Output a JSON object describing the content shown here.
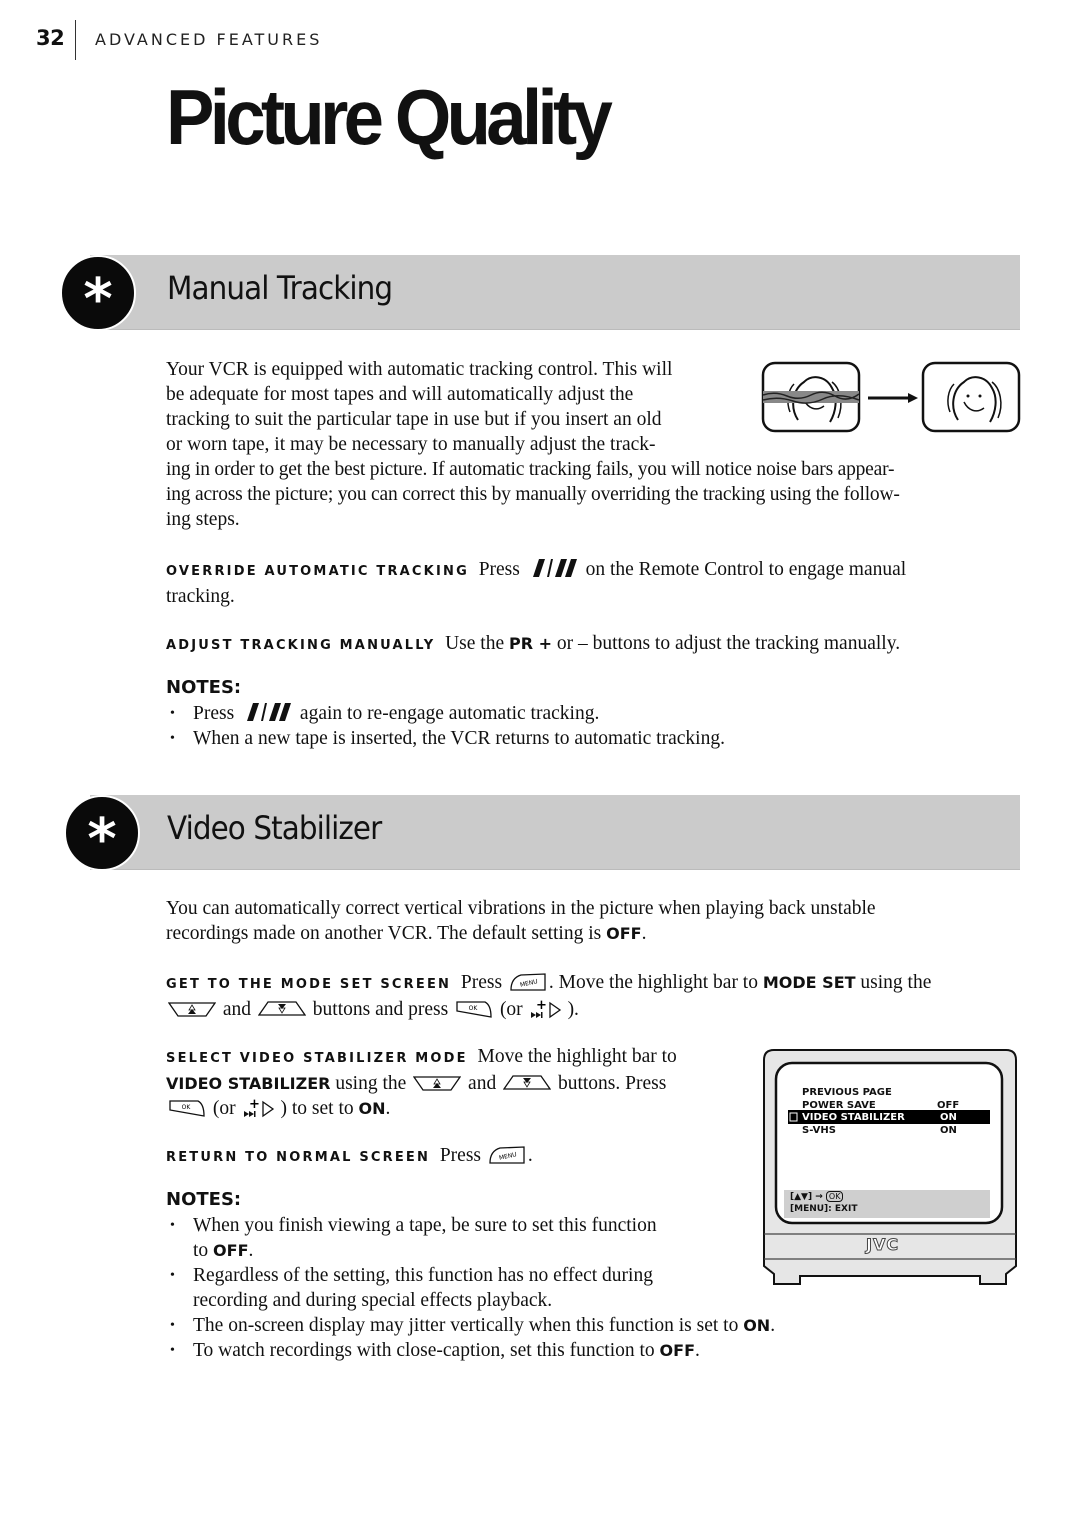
{
  "header": {
    "page_number": "32",
    "section": "ADVANCED FEATURES",
    "title": "Picture Quality"
  },
  "manual_tracking": {
    "heading": "Manual Tracking",
    "badge_icon": "asterisk-icon",
    "intro_lines": [
      "Your VCR is equipped with automatic tracking control. This will",
      "be adequate for most tapes and will automatically adjust the",
      "tracking to suit the particular tape in use but if you insert an old",
      "or worn tape, it may be necessary to manually adjust the track-"
    ],
    "intro_lines_wide": [
      "ing in order to get the best picture. If automatic tracking fails, you will notice noise bars appear-",
      "ing across the picture; you can correct this by manually overriding the tracking using the follow-",
      "ing steps."
    ],
    "illustration": {
      "before": "noisy-tv-picture-icon",
      "arrow": "arrow-right-icon",
      "after": "clear-tv-picture-icon"
    },
    "steps": [
      {
        "lead": "OVERRIDE AUTOMATIC TRACKING",
        "pre": "Press",
        "icon": "tracking-button-icon",
        "post": "on the Remote Control to engage manual",
        "cont": "tracking."
      },
      {
        "lead": "ADJUST TRACKING MANUALLY",
        "pre": "Use the",
        "bold": "PR +",
        "post": "or – buttons to adjust the tracking manually."
      }
    ],
    "notes_heading": "NOTES:",
    "notes": [
      {
        "pre": "Press",
        "icon": "tracking-button-icon",
        "post": "again to re-engage automatic tracking."
      },
      {
        "text": "When a new tape is inserted, the VCR returns to automatic tracking."
      }
    ]
  },
  "video_stabilizer": {
    "heading": "Video Stabilizer",
    "badge_icon": "asterisk-icon",
    "intro_line1": "You can automatically correct vertical vibrations in the picture when playing back unstable",
    "intro_line2_pre": "recordings made on another VCR. The default setting is",
    "intro_line2_bold": "OFF",
    "intro_line2_post": ".",
    "step1": {
      "lead": "GET TO THE MODE SET SCREEN",
      "pre": "Press",
      "mid": ". Move the highlight bar to",
      "bold": "MODE SET",
      "post": "using the",
      "l2_and": "and",
      "l2_mid": "buttons and press",
      "l2_or": "(or",
      "l2_end": ")."
    },
    "step2": {
      "lead": "SELECT VIDEO STABILIZER MODE",
      "l1": "Move the highlight bar to",
      "l2_bold": "VIDEO STABILIZER",
      "l2_pre": "using the",
      "l2_and": "and",
      "l2_post": "buttons. Press",
      "l3_or": "(or",
      "l3_mid": ") to set to",
      "l3_bold": "ON",
      "l3_end": "."
    },
    "step3": {
      "lead": "RETURN TO NORMAL SCREEN",
      "pre": "Press",
      "post": "."
    },
    "notes_heading": "NOTES:",
    "notes": [
      {
        "l1": "When you finish viewing a tape, be sure to set this function",
        "l2_pre": "to",
        "bold": "OFF",
        "post": "."
      },
      {
        "l1": "Regardless of the setting, this function has no effect during",
        "l2": "recording and during special effects playback."
      },
      {
        "pre": "The on-screen display may jitter vertically when this function is set to",
        "bold": "ON",
        "post": "."
      },
      {
        "pre": "To watch recordings with close-caption, set this function to",
        "bold": "OFF",
        "post": "."
      }
    ],
    "tv_screen": {
      "menu": [
        {
          "label": "PREVIOUS PAGE",
          "value": ""
        },
        {
          "label": "POWER SAVE",
          "value": "OFF"
        },
        {
          "label": "VIDEO STABILIZER",
          "value": "ON",
          "selected": true
        },
        {
          "label": "S-VHS",
          "value": "ON"
        }
      ],
      "help_line1": "[▲▼] →",
      "help_ok": "OK",
      "help_line2": "[MENU]: EXIT",
      "brand": "JVC"
    }
  },
  "remote_buttons": {
    "menu": "MENU",
    "ok": "OK",
    "up": "up-button-icon",
    "down": "down-button-icon",
    "forward": "plus-fast-forward-icon"
  }
}
